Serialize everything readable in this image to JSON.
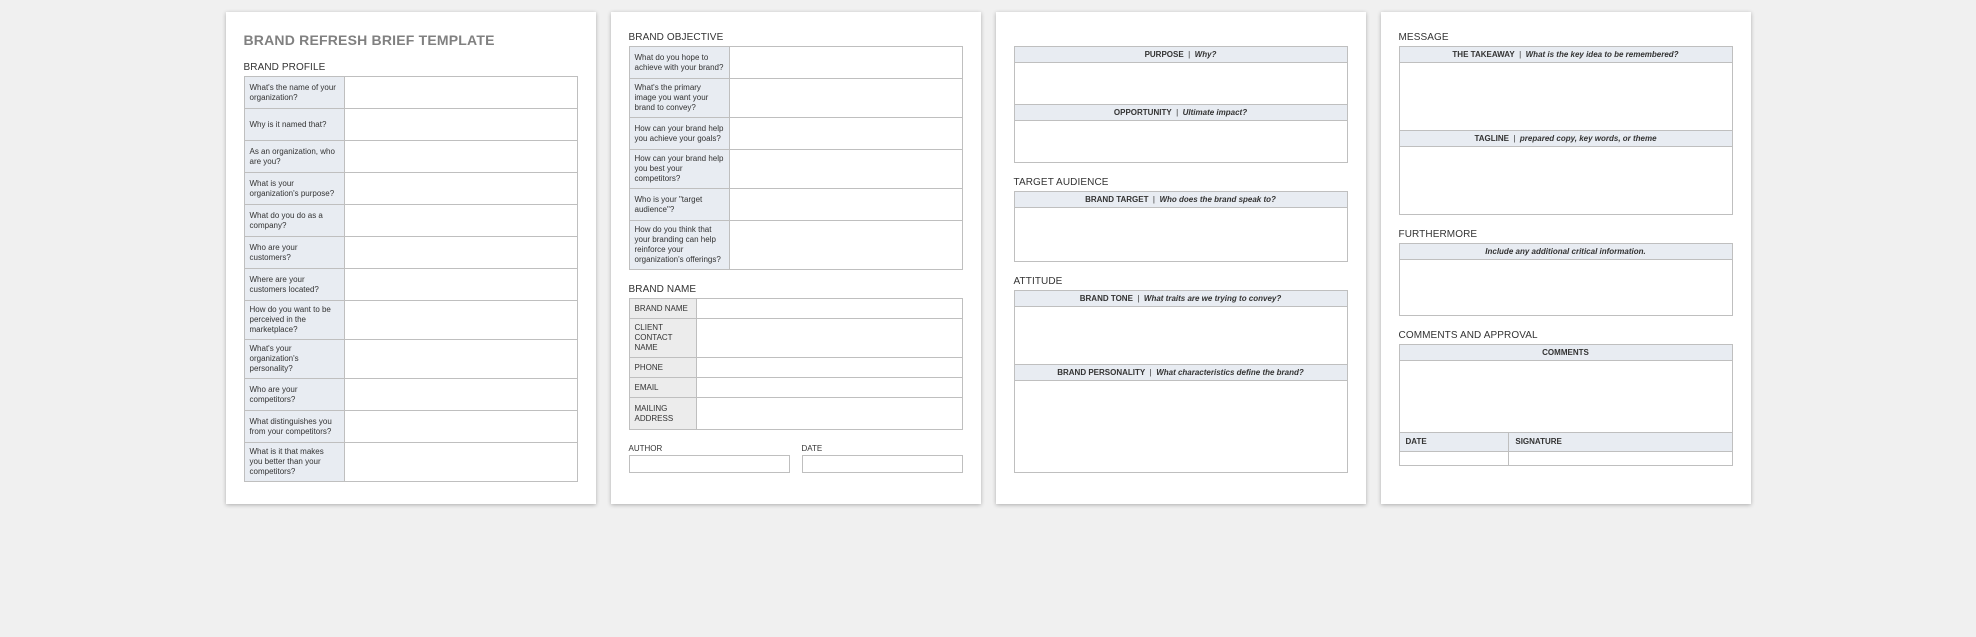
{
  "title": "BRAND REFRESH BRIEF TEMPLATE",
  "sections": {
    "profile": {
      "heading": "BRAND PROFILE",
      "rows": [
        "What's the name of your organization?",
        "Why is it named that?",
        "As an organization, who are you?",
        "What is your organization's purpose?",
        "What do you do as a company?",
        "Who are your customers?",
        "Where are your customers located?",
        "How do you want to be perceived in the marketplace?",
        "What's your organization's personality?",
        "Who are your competitors?",
        "What distinguishes you from your competitors?",
        "What is it that makes you better than your competitors?"
      ]
    },
    "objective": {
      "heading": "BRAND OBJECTIVE",
      "rows": [
        "What do you hope to achieve with your brand?",
        "What's the primary image you want your brand to convey?",
        "How can your brand help you achieve your goals?",
        "How can your brand help you best your competitors?",
        "Who is your \"target audience\"?",
        "How do you think that your branding can help reinforce your organization's offerings?"
      ]
    },
    "brandname": {
      "heading": "BRAND NAME",
      "rows": [
        "BRAND NAME",
        "CLIENT CONTACT NAME",
        "PHONE",
        "EMAIL",
        "MAILING ADDRESS"
      ]
    },
    "author_label": "AUTHOR",
    "date_label": "DATE",
    "purpose": {
      "label": "PURPOSE",
      "sub": "Why?"
    },
    "opportunity": {
      "label": "OPPORTUNITY",
      "sub": "Ultimate impact?"
    },
    "target": {
      "heading": "TARGET AUDIENCE",
      "label": "BRAND TARGET",
      "sub": "Who does the brand speak to?"
    },
    "attitude": {
      "heading": "ATTITUDE",
      "tone": {
        "label": "BRAND TONE",
        "sub": "What traits are we trying to convey?"
      },
      "personality": {
        "label": "BRAND PERSONALITY",
        "sub": "What characteristics define the brand?"
      }
    },
    "message": {
      "heading": "MESSAGE",
      "takeaway": {
        "label": "THE TAKEAWAY",
        "sub": "What is the key idea to be remembered?"
      },
      "tagline": {
        "label": "TAGLINE",
        "sub": "prepared copy, key words, or theme"
      }
    },
    "furthermore": {
      "heading": "FURTHERMORE",
      "sub": "Include any additional critical information."
    },
    "comments": {
      "heading": "COMMENTS AND APPROVAL",
      "comments_label": "COMMENTS",
      "date_label": "DATE",
      "signature_label": "SIGNATURE"
    }
  }
}
